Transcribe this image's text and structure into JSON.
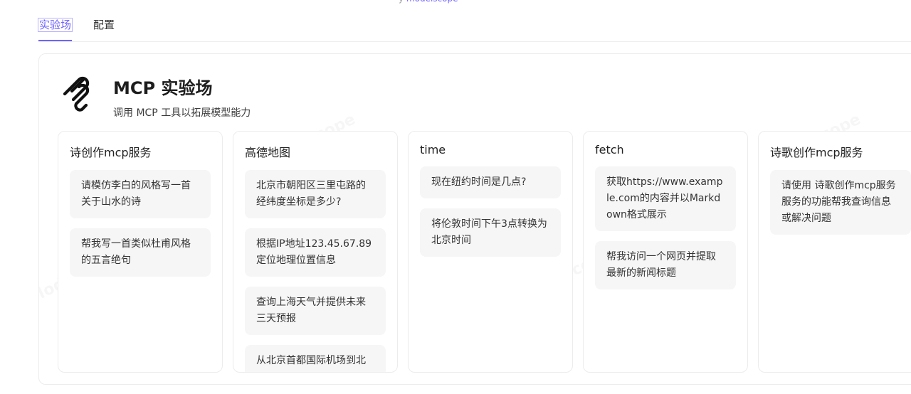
{
  "top_strip": {
    "text": "y",
    "link": "modelscope"
  },
  "tabs": [
    {
      "label": "实验场",
      "active": true
    },
    {
      "label": "配置",
      "active": false
    }
  ],
  "header": {
    "title": "MCP 实验场",
    "subtitle": "调用 MCP 工具以拓展模型能力",
    "logo_icon": "mcp-logo-icon"
  },
  "watermark": "ModelScope",
  "columns": [
    {
      "title": "诗创作mcp服务",
      "prompts": [
        "请模仿李白的风格写一首关于山水的诗",
        "帮我写一首类似杜甫风格的五言绝句"
      ]
    },
    {
      "title": "高德地图",
      "prompts": [
        "北京市朝阳区三里屯路的经纬度坐标是多少?",
        "根据IP地址123.45.67.89定位地理位置信息",
        "查询上海天气并提供未来三天预报",
        "从北京首都国际机场到北"
      ]
    },
    {
      "title": "time",
      "prompts": [
        "现在纽约时间是几点?",
        "将伦敦时间下午3点转换为北京时间"
      ]
    },
    {
      "title": "fetch",
      "prompts": [
        "获取https://www.example.com的内容并以Markdown格式展示",
        "帮我访问一个网页并提取最新的新闻标题"
      ]
    },
    {
      "title": "诗歌创作mcp服务",
      "prompts": [
        "请使用 诗歌创作mcp服务 服务的功能帮我查询信息或解决问题"
      ]
    }
  ]
}
